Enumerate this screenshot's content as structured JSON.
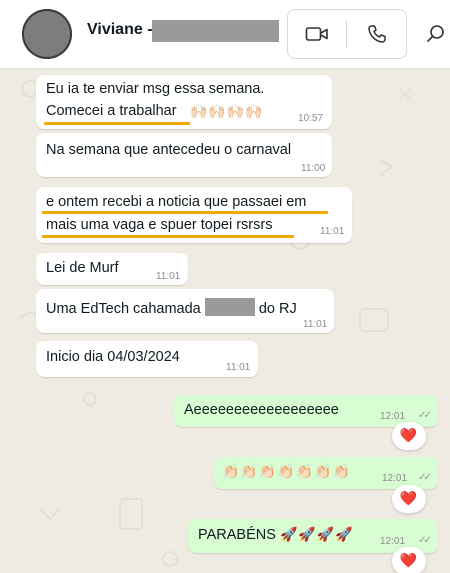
{
  "header": {
    "contact_name": "Viviane -",
    "icons": {
      "video": "video-call-icon",
      "phone": "voice-call-icon",
      "search": "search-icon"
    }
  },
  "messages": [
    {
      "direction": "incoming",
      "lines": [
        "Eu ia te enviar msg essa semana.",
        "Comecei a trabalhar"
      ],
      "emoji": "🙌🏻🙌🏻🙌🏻🙌🏻",
      "time": "10:57"
    },
    {
      "direction": "incoming",
      "lines": [
        "Na semana que antecedeu o carnaval"
      ],
      "time": "11:00"
    },
    {
      "direction": "incoming",
      "lines": [
        "e ontem recebi a noticia que passaei em",
        "mais uma vaga e spuer topei rsrsrs"
      ],
      "time": "11:01"
    },
    {
      "direction": "incoming",
      "lines": [
        "Lei de Murf"
      ],
      "time": "11:01"
    },
    {
      "direction": "incoming",
      "text_before": "Uma EdTech cahamada",
      "text_after": "do  RJ",
      "time": "11:01"
    },
    {
      "direction": "incoming",
      "lines": [
        "Inicio dia 04/03/2024"
      ],
      "time": "11:01"
    },
    {
      "direction": "outgoing",
      "lines": [
        "Aeeeeeeeeeeeeeeeeee"
      ],
      "time": "12:01",
      "read": true,
      "reaction": "❤️"
    },
    {
      "direction": "outgoing",
      "emoji": "👏🏻👏🏻👏🏻👏🏻👏🏻👏🏻👏🏻",
      "time": "12:01",
      "read": true,
      "reaction": "❤️"
    },
    {
      "direction": "outgoing",
      "lines": [
        "PARABÉNS"
      ],
      "emoji": "🚀🚀🚀🚀",
      "time": "12:01",
      "read": true,
      "reaction": "❤️"
    }
  ],
  "colors": {
    "chat_background": "#efeae2",
    "incoming_bubble": "#ffffff",
    "outgoing_bubble": "#d9fdd3",
    "highlight_underline": "#f5a800",
    "reaction_heart": "#e0245e"
  }
}
